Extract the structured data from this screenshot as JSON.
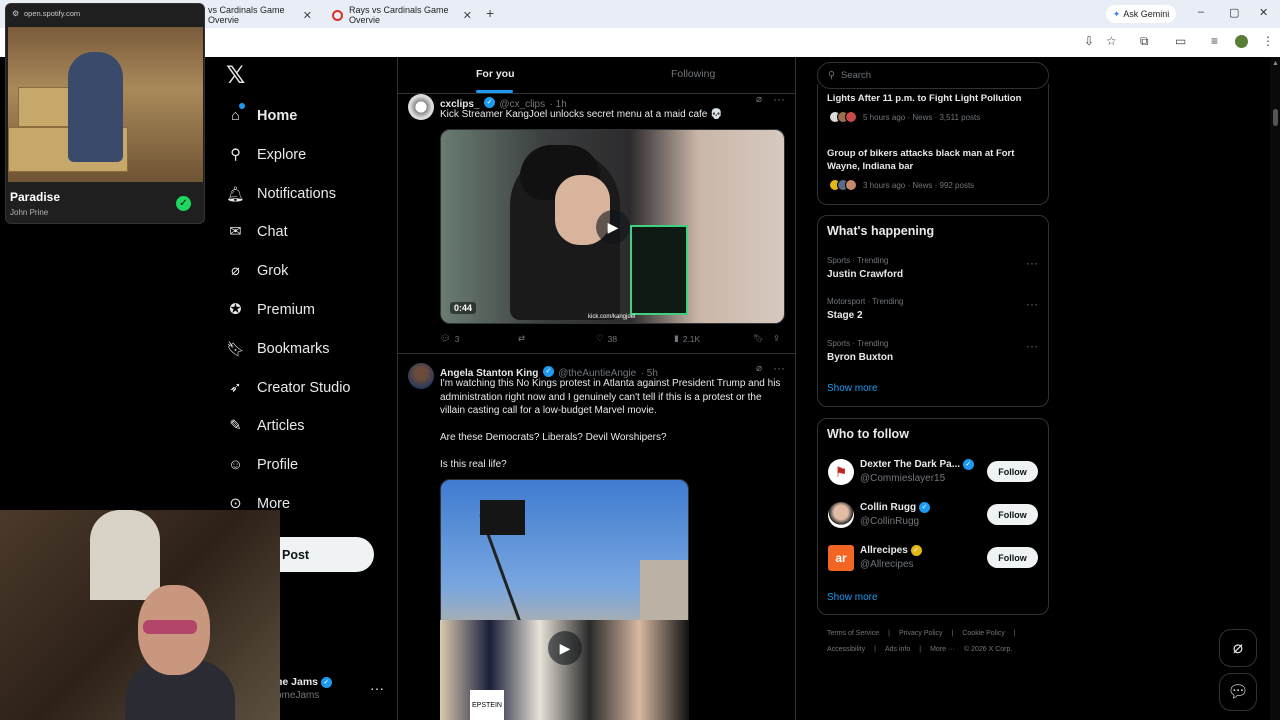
{
  "browser": {
    "tabs": [
      {
        "label": "vs Cardinals Game Overvie"
      },
      {
        "label": "Rays vs Cardinals Game Overvie"
      }
    ],
    "new_tab": "+",
    "ask_gemini": "Ask Gemini",
    "window_controls": [
      "–",
      "▢",
      "✕"
    ]
  },
  "spotify": {
    "url": "open.spotify.com",
    "track": "Paradise",
    "artist": "John Prine"
  },
  "nav": {
    "items": [
      {
        "label": "Home",
        "icon": "home-icon"
      },
      {
        "label": "Explore",
        "icon": "search-icon"
      },
      {
        "label": "Notifications",
        "icon": "bell-icon"
      },
      {
        "label": "Chat",
        "icon": "mail-icon"
      },
      {
        "label": "Grok",
        "icon": "grok-icon"
      },
      {
        "label": "Premium",
        "icon": "verified-icon"
      },
      {
        "label": "Bookmarks",
        "icon": "bookmark-icon"
      },
      {
        "label": "Creator Studio",
        "icon": "rocket-icon"
      },
      {
        "label": "Articles",
        "icon": "article-icon"
      },
      {
        "label": "Profile",
        "icon": "person-icon"
      },
      {
        "label": "More",
        "icon": "more-circle-icon"
      }
    ],
    "post_button": "Post",
    "account_name": "ne Jams",
    "account_handle": "omeJams"
  },
  "timeline": {
    "tab_for_you": "For you",
    "tab_following": "Following",
    "posts": [
      {
        "name": "cxclips_",
        "handle": "@cx_clips",
        "time": "· 1h",
        "text": "Kick Streamer KangJoel unlocks secret menu at a maid cafe 💀",
        "video_time": "0:44",
        "watermark": "kick.com/kangjoel",
        "replies": "3",
        "likes": "38",
        "views": "2.1K"
      },
      {
        "name": "Angela Stanton King",
        "handle": "@theAuntieAngie",
        "time": "· 5h",
        "text": "I'm watching this No Kings protest in Atlanta against President Trump and his administration right now and I genuinely can't tell if this is a protest or the villain casting call for a low-budget Marvel movie.",
        "text2": "Are these Democrats? Liberals? Devil Worshipers?",
        "text3": "Is this real life?",
        "sign": "EPSTEIN"
      }
    ]
  },
  "sidebar": {
    "search_placeholder": "Search",
    "news": [
      {
        "title": "Lights After 11 p.m. to Fight Light Pollution",
        "meta": "5 hours ago · News · 3,511 posts"
      },
      {
        "title": "Group of bikers attacks black man at Fort Wayne, Indiana bar",
        "meta": "3 hours ago · News · 992 posts"
      }
    ],
    "happening_title": "What's happening",
    "trends": [
      {
        "meta": "Sports · Trending",
        "name": "Justin Crawford"
      },
      {
        "meta": "Motorsport · Trending",
        "name": "Stage 2"
      },
      {
        "meta": "Sports · Trending",
        "name": "Byron Buxton"
      }
    ],
    "show_more": "Show more",
    "follow_title": "Who to follow",
    "who_to_follow": [
      {
        "name": "Dexter The Dark Pa...",
        "handle": "@Commieslayer15",
        "badge_color": "#1d9bf0"
      },
      {
        "name": "Collin Rugg",
        "handle": "@CollinRugg",
        "badge_color": "#1d9bf0"
      },
      {
        "name": "Allrecipes",
        "handle": "@Allrecipes",
        "badge_color": "#e2b719"
      }
    ],
    "follow_label": "Follow",
    "footer_line1": [
      "Terms of Service",
      "|",
      "Privacy Policy",
      "|",
      "Cookie Policy",
      "|"
    ],
    "footer_line2": [
      "Accessibility",
      "|",
      "Ads info",
      "|",
      "More ···",
      "© 2026 X Corp."
    ]
  },
  "colors": {
    "accent": "#1d9bf0",
    "background": "#000000",
    "border": "#2f3336",
    "gold_badge": "#e2b719"
  }
}
